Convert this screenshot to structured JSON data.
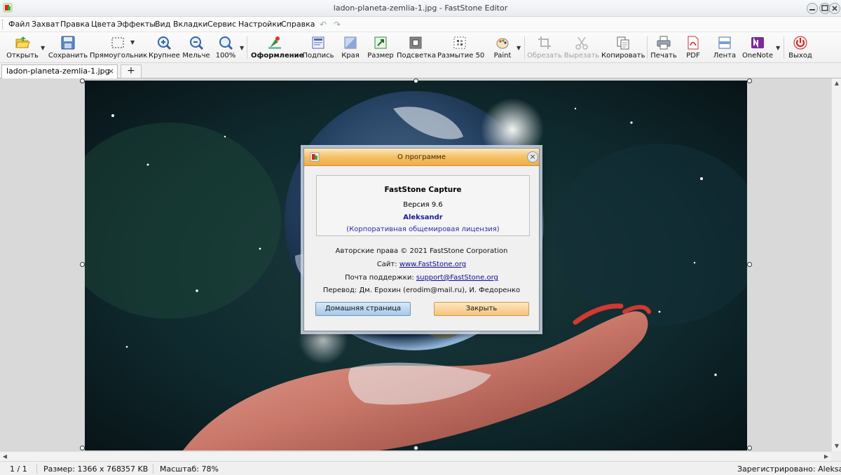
{
  "window": {
    "title": "ladon-planeta-zemlia-1.jpg - FastStone Editor",
    "undo_glyph": "↶",
    "redo_glyph": "↷"
  },
  "menu": [
    "Файл",
    "Захват",
    "Правка",
    "Цвета",
    "Эффекты",
    "Вид",
    "Вкладки",
    "Сервис",
    "Настройки",
    "Справка"
  ],
  "toolbar": {
    "open": "Открыть",
    "save": "Сохранить",
    "rect": "Прямоугольник",
    "zoom_in": "Крупнее",
    "zoom_out": "Мельче",
    "zoom_100": "100%",
    "decorate": "Оформление",
    "caption": "Подпись",
    "edges": "Края",
    "resize": "Размер",
    "spotlight": "Подсветка",
    "blur": "Размытие 50",
    "paint": "Paint",
    "crop": "Обрезать",
    "cut": "Вырезать",
    "copy": "Копировать",
    "print": "Печать",
    "pdf": "PDF",
    "tape": "Лента",
    "onenote": "OneNote",
    "exit": "Выход"
  },
  "tabs": {
    "active": "ladon-planeta-zemlia-1.jpg",
    "close_glyph": "×",
    "new_glyph": "+"
  },
  "status": {
    "page": "1 / 1",
    "size": "Размер: 1366 x 768",
    "filesize": "357 KB",
    "zoom": "Масштаб: 78%",
    "registered": "Зарегистрировано: Aleksandr"
  },
  "dialog": {
    "title": "О программе",
    "product": "FastStone Capture",
    "version": "Версия 9.6",
    "user": "Aleksandr",
    "license": "(Корпоративная общемировая лицензия)",
    "copyright": "Авторские права © 2021 FastStone Corporation",
    "site_label": "Сайт:",
    "site_link": "www.FastStone.org",
    "support_label": "Почта поддержки:",
    "support_link": "support@FastStone.org",
    "translation": "Перевод: Дм. Ерохин (erodim@mail.ru), И. Федоренко",
    "home_button": "Домашняя страница",
    "close_button": "Закрыть"
  },
  "colors": {
    "dialog_title": "#f5c065",
    "link": "#0d0d8f",
    "user_name": "#1a1aa0"
  }
}
